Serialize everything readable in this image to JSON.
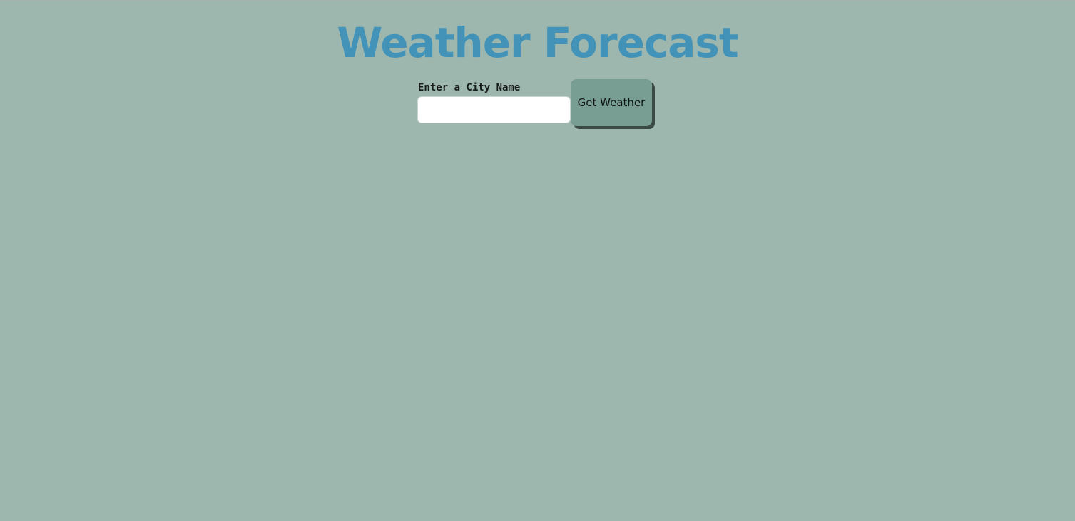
{
  "page": {
    "title": "Weather Forecast"
  },
  "search": {
    "label": "Enter a City Name",
    "value": "",
    "placeholder": "",
    "button_label": "Get Weather"
  },
  "colors": {
    "background": "#9db7ae",
    "title": "#4393b9",
    "button": "#789e93",
    "button_shadow": "#3b4a44"
  }
}
